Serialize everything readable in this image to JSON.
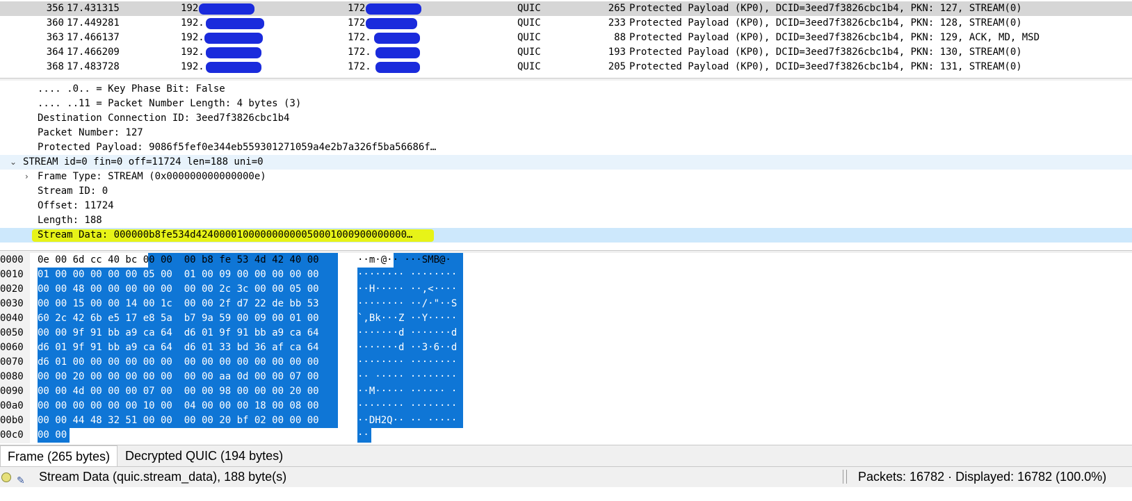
{
  "packet_list": {
    "rows": [
      {
        "no": "356",
        "time": "17.431315",
        "src": "192.",
        "dst": "172.",
        "proto": "QUIC",
        "len": "265",
        "info": "Protected Payload (KP0), DCID=3eed7f3826cbc1b4, PKN: 127, STREAM(0)"
      },
      {
        "no": "360",
        "time": "17.449281",
        "src": "192.",
        "dst": "172.",
        "proto": "QUIC",
        "len": "233",
        "info": "Protected Payload (KP0), DCID=3eed7f3826cbc1b4, PKN: 128, STREAM(0)"
      },
      {
        "no": "363",
        "time": "17.466137",
        "src": "192.",
        "dst": "172.",
        "proto": "QUIC",
        "len": "88",
        "info": "Protected Payload (KP0), DCID=3eed7f3826cbc1b4, PKN: 129, ACK, MD, MSD"
      },
      {
        "no": "364",
        "time": "17.466209",
        "src": "192.",
        "dst": "172.",
        "proto": "QUIC",
        "len": "193",
        "info": "Protected Payload (KP0), DCID=3eed7f3826cbc1b4, PKN: 130, STREAM(0)"
      },
      {
        "no": "368",
        "time": "17.483728",
        "src": "192.",
        "dst": "172.",
        "proto": "QUIC",
        "len": "205",
        "info": "Protected Payload (KP0), DCID=3eed7f3826cbc1b4, PKN: 131, STREAM(0)"
      }
    ]
  },
  "details": {
    "key_phase": ".... .0.. = Key Phase Bit: False",
    "pn_length": ".... ..11 = Packet Number Length: 4 bytes (3)",
    "dcid": "Destination Connection ID: 3eed7f3826cbc1b4",
    "packet_number": "Packet Number: 127",
    "protected_payload": "Protected Payload: 9086f5fef0e344eb559301271059a4e2b7a326f5ba56686f…",
    "stream": "STREAM id=0 fin=0 off=11724 len=188 uni=0",
    "frame_type": "Frame Type: STREAM (0x000000000000000e)",
    "stream_id": "Stream ID: 0",
    "offset": "Offset: 11724",
    "length": "Length: 188",
    "stream_data": "Stream Data: 000000b8fe534d424000010000000000050001000900000000…",
    "expanded_arrow": "⌄",
    "collapsed_arrow": "›"
  },
  "hex_dump": {
    "rows": [
      {
        "off": "0000",
        "bytes": "0e 00 6d cc 40 bc 00 00  00 b8 fe 53 4d 42 40 00",
        "ascii": "··m·@·· ···SMB@·"
      },
      {
        "off": "0010",
        "bytes": "01 00 00 00 00 00 05 00  01 00 09 00 00 00 00 00",
        "ascii": "········ ········"
      },
      {
        "off": "0020",
        "bytes": "00 00 48 00 00 00 00 00  00 00 2c 3c 00 00 05 00",
        "ascii": "··H····· ··,<····"
      },
      {
        "off": "0030",
        "bytes": "00 00 15 00 00 14 00 1c  00 00 2f d7 22 de bb 53",
        "ascii": "········ ··/·\"··S"
      },
      {
        "off": "0040",
        "bytes": "60 2c 42 6b e5 17 e8 5a  b7 9a 59 00 09 00 01 00",
        "ascii": "`,Bk···Z ··Y·····"
      },
      {
        "off": "0050",
        "bytes": "00 00 9f 91 bb a9 ca 64  d6 01 9f 91 bb a9 ca 64",
        "ascii": "·······d ·······d"
      },
      {
        "off": "0060",
        "bytes": "d6 01 9f 91 bb a9 ca 64  d6 01 33 bd 36 af ca 64",
        "ascii": "·······d ··3·6··d"
      },
      {
        "off": "0070",
        "bytes": "d6 01 00 00 00 00 00 00  00 00 00 00 00 00 00 00",
        "ascii": "········ ········"
      },
      {
        "off": "0080",
        "bytes": "00 00 20 00 00 00 00 00  00 00 aa 0d 00 00 07 00",
        "ascii": "·· ····· ········"
      },
      {
        "off": "0090",
        "bytes": "00 00 4d 00 00 00 07 00  00 00 98 00 00 00 20 00",
        "ascii": "··M····· ······ ·"
      },
      {
        "off": "00a0",
        "bytes": "00 00 00 00 00 00 10 00  04 00 00 00 18 00 08 00",
        "ascii": "········ ········"
      },
      {
        "off": "00b0",
        "bytes": "00 00 44 48 32 51 00 00  00 00 20 bf 02 00 00 00",
        "ascii": "··DH2Q·· ·· ·····"
      },
      {
        "off": "00c0",
        "bytes": "00 00",
        "ascii": "··"
      }
    ]
  },
  "tabs": [
    {
      "label": "Frame (265 bytes)"
    },
    {
      "label": "Decrypted QUIC (194 bytes)"
    }
  ],
  "status": {
    "field": "Stream Data (quic.stream_data), 188 byte(s)",
    "packets": "Packets: 16782 · Displayed: 16782 (100.0%)"
  },
  "colors": {
    "selection": "#0f76d6",
    "redaction": "#1a2bdc",
    "highlight": "#e7f318"
  }
}
